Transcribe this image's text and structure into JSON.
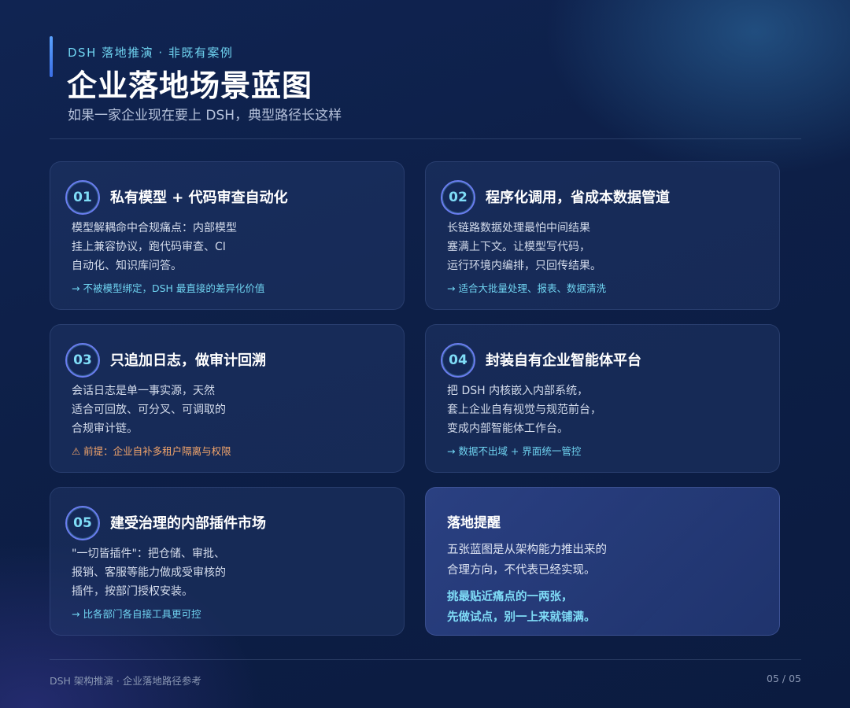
{
  "header": {
    "kicker": "DSH 落地推演 · 非既有案例",
    "title": "企业落地场景蓝图",
    "subtitle": "如果一家企业现在要上 DSH，典型路径长这样"
  },
  "cards": [
    {
      "number": "01",
      "title": "私有模型 + 代码审查自动化",
      "body": [
        "模型解耦命中合规痛点：内部模型",
        "挂上兼容协议，跑代码审查、CI",
        "自动化、知识库问答。"
      ],
      "note": "→ 不被模型绑定，DSH 最直接的差异化价值"
    },
    {
      "number": "02",
      "title": "程序化调用，省成本数据管道",
      "body": [
        "长链路数据处理最怕中间结果",
        "塞满上下文。让模型写代码，",
        "运行环境内编排，只回传结果。"
      ],
      "note": "→ 适合大批量处理、报表、数据清洗"
    },
    {
      "number": "03",
      "title": "只追加日志，做审计回溯",
      "body": [
        "会话日志是单一事实源，天然",
        "适合可回放、可分叉、可调取的",
        "合规审计链。"
      ],
      "note": "⚠ 前提：企业自补多租户隔离与权限"
    },
    {
      "number": "04",
      "title": "封装自有企业智能体平台",
      "body": [
        "把 DSH 内核嵌入内部系统，",
        "套上企业自有视觉与规范前台，",
        "变成内部智能体工作台。"
      ],
      "note": "→ 数据不出域 + 界面统一管控"
    },
    {
      "number": "05",
      "title": "建受治理的内部插件市场",
      "body": [
        "\"一切皆插件\"：把仓储、审批、",
        "报销、客服等能力做成受审核的",
        "插件，按部门授权安装。"
      ],
      "note": "→ 比各部门各自接工具更可控"
    }
  ],
  "tip": {
    "title": "落地提醒",
    "body": [
      "五张蓝图是从架构能力推出来的",
      "合理方向，不代表已经实现。"
    ],
    "emphasis": [
      "挑最贴近痛点的一两张，",
      "先做试点，别一上来就铺满。"
    ]
  },
  "footer": {
    "left": "DSH 架构推演 · 企业落地路径参考",
    "right": "05 / 05"
  },
  "colors": {
    "accent_cyan": "#6fd3f0",
    "warning_orange": "#f3a56b",
    "background": "#0d1f47"
  }
}
